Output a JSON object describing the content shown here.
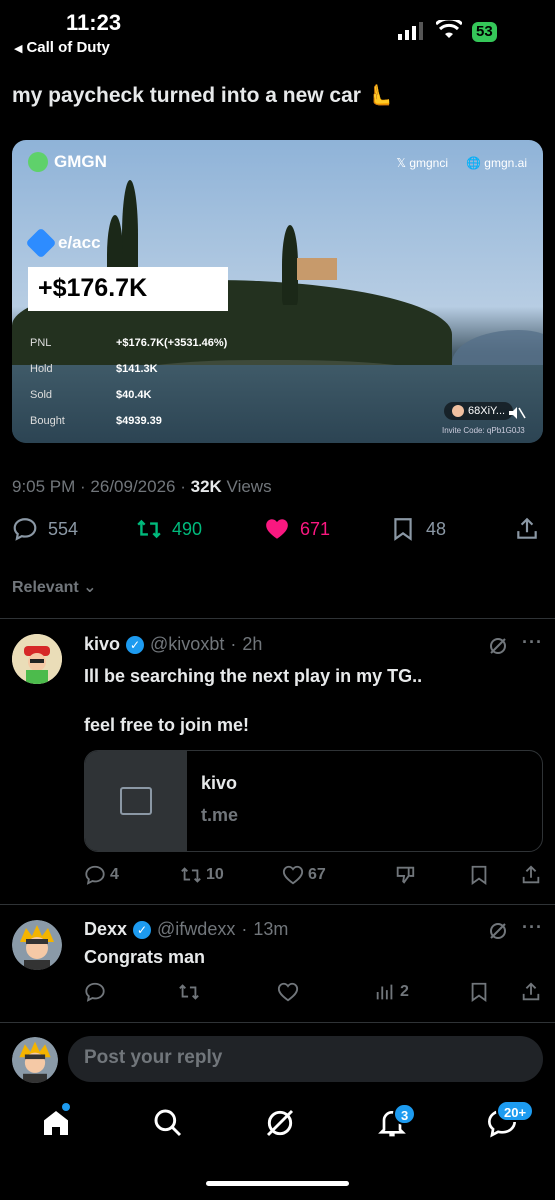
{
  "status_bar": {
    "time": "11:23",
    "back_app": "Call of Duty",
    "battery": "53"
  },
  "post": {
    "text": "my paycheck turned into a new car 🫷",
    "media": {
      "brand": "GMGN",
      "handle_x": "gmgnci",
      "site": "gmgn.ai",
      "token": "e/acc",
      "headline": "+$176.7K",
      "stats": [
        {
          "label": "PNL",
          "value": "+$176.7K(+3531.46%)"
        },
        {
          "label": "Hold",
          "value": "$141.3K"
        },
        {
          "label": "Sold",
          "value": "$40.4K"
        },
        {
          "label": "Bought",
          "value": "$4939.39"
        }
      ],
      "wallet": "68XiY...",
      "invite": "Invite Code: qPb1G0J3"
    },
    "time": "9:05 PM",
    "date": "26/09/2026",
    "views_count": "32K",
    "views_label": "Views",
    "replies": "554",
    "reposts": "490",
    "likes": "671",
    "bookmarks": "48"
  },
  "sort_label": "Relevant",
  "replies": [
    {
      "name": "kivo",
      "handle": "@kivoxbt",
      "age": "2h",
      "text_line1": "Ill be searching the next play in my TG..",
      "text_line2": "feel free to join me!",
      "card_title": "kivo",
      "card_domain": "t.me",
      "reply_count": "4",
      "repost_count": "10",
      "like_count": "67"
    },
    {
      "name": "Dexx",
      "handle": "@ifwdexx",
      "age": "13m",
      "text_line1": "Congrats man",
      "views_count": "2"
    }
  ],
  "reply_input": {
    "placeholder": "Post your reply"
  },
  "tabbar": {
    "notifications_badge": "3",
    "messages_badge": "20+"
  },
  "colors": {
    "accent": "#1d9bf0",
    "repost_green": "#00ba7c",
    "like_pink": "#f91880",
    "muted": "#71767b"
  }
}
